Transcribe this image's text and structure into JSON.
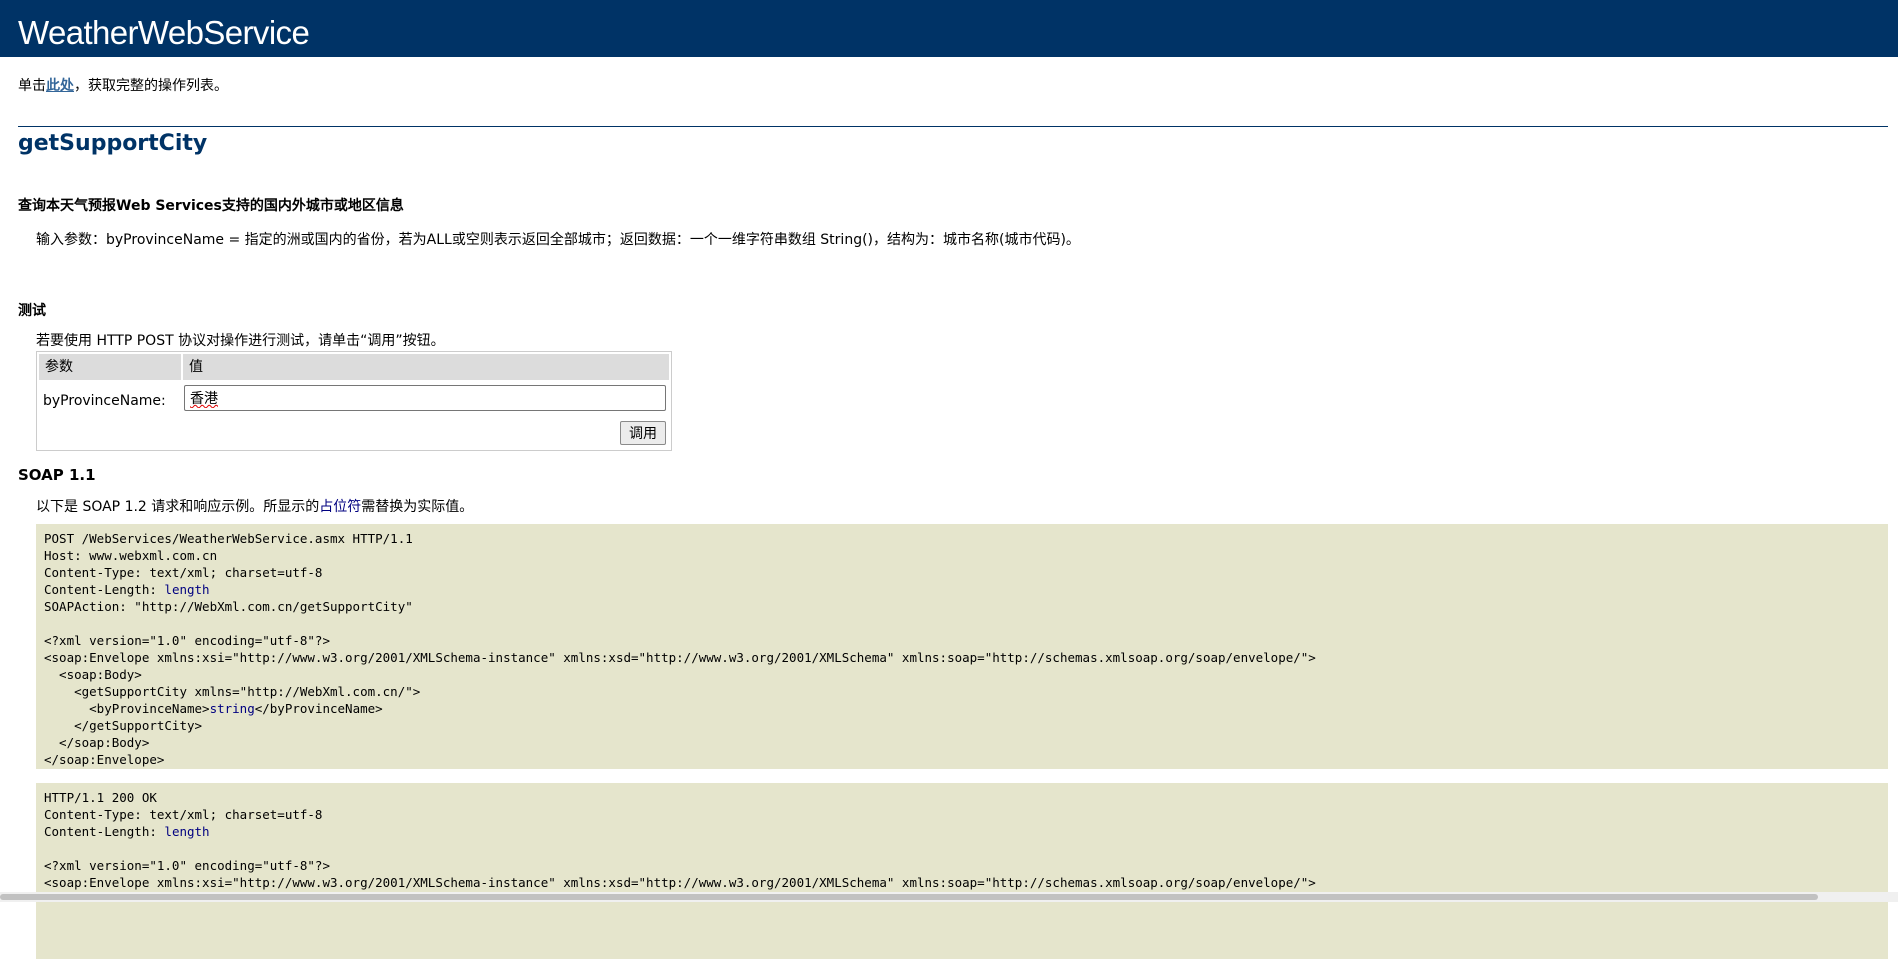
{
  "header": {
    "title": "WeatherWebService"
  },
  "intro": {
    "prefix": "单击",
    "link": "此处",
    "suffix": "，获取完整的操作列表。"
  },
  "operation": {
    "name": "getSupportCity",
    "description_title": "查询本天气预报Web Services支持的国内外城市或地区信息",
    "description": "输入参数：byProvinceName = 指定的洲或国内的省份，若为ALL或空则表示返回全部城市；返回数据：一个一维字符串数组 String()，结构为：城市名称(城市代码)。"
  },
  "test": {
    "title": "测试",
    "hint": "若要使用 HTTP POST 协议对操作进行测试，请单击“调用”按钮。",
    "table": {
      "col_param": "参数",
      "col_value": "值",
      "param_label": "byProvinceName:",
      "param_value": "香港",
      "invoke_label": "调用"
    }
  },
  "soap": {
    "title": "SOAP 1.1",
    "hint_prefix": "以下是 SOAP 1.2 请求和响应示例。所显示的",
    "hint_placeholder": "占位符",
    "hint_suffix": "需替换为实际值。",
    "request": {
      "line1": "POST /WebServices/WeatherWebService.asmx HTTP/1.1",
      "line2": "Host: www.webxml.com.cn",
      "line3": "Content-Type: text/xml; charset=utf-8",
      "line4_prefix": "Content-Length: ",
      "line4_value": "length",
      "line5": "SOAPAction: \"http://WebXml.com.cn/getSupportCity\"",
      "line7": "<?xml version=\"1.0\" encoding=\"utf-8\"?>",
      "line8": "<soap:Envelope xmlns:xsi=\"http://www.w3.org/2001/XMLSchema-instance\" xmlns:xsd=\"http://www.w3.org/2001/XMLSchema\" xmlns:soap=\"http://schemas.xmlsoap.org/soap/envelope/\">",
      "line9": "  <soap:Body>",
      "line10": "    <getSupportCity xmlns=\"http://WebXml.com.cn/\">",
      "line11_prefix": "      <byProvinceName>",
      "line11_value": "string",
      "line11_suffix": "</byProvinceName>",
      "line12": "    </getSupportCity>",
      "line13": "  </soap:Body>",
      "line14": "</soap:Envelope>"
    },
    "response": {
      "line1": "HTTP/1.1 200 OK",
      "line2": "Content-Type: text/xml; charset=utf-8",
      "line3_prefix": "Content-Length: ",
      "line3_value": "length",
      "line5": "<?xml version=\"1.0\" encoding=\"utf-8\"?>",
      "line6": "<soap:Envelope xmlns:xsi=\"http://www.w3.org/2001/XMLSchema-instance\" xmlns:xsd=\"http://www.w3.org/2001/XMLSchema\" xmlns:soap=\"http://schemas.xmlsoap.org/soap/envelope/\">"
    }
  }
}
